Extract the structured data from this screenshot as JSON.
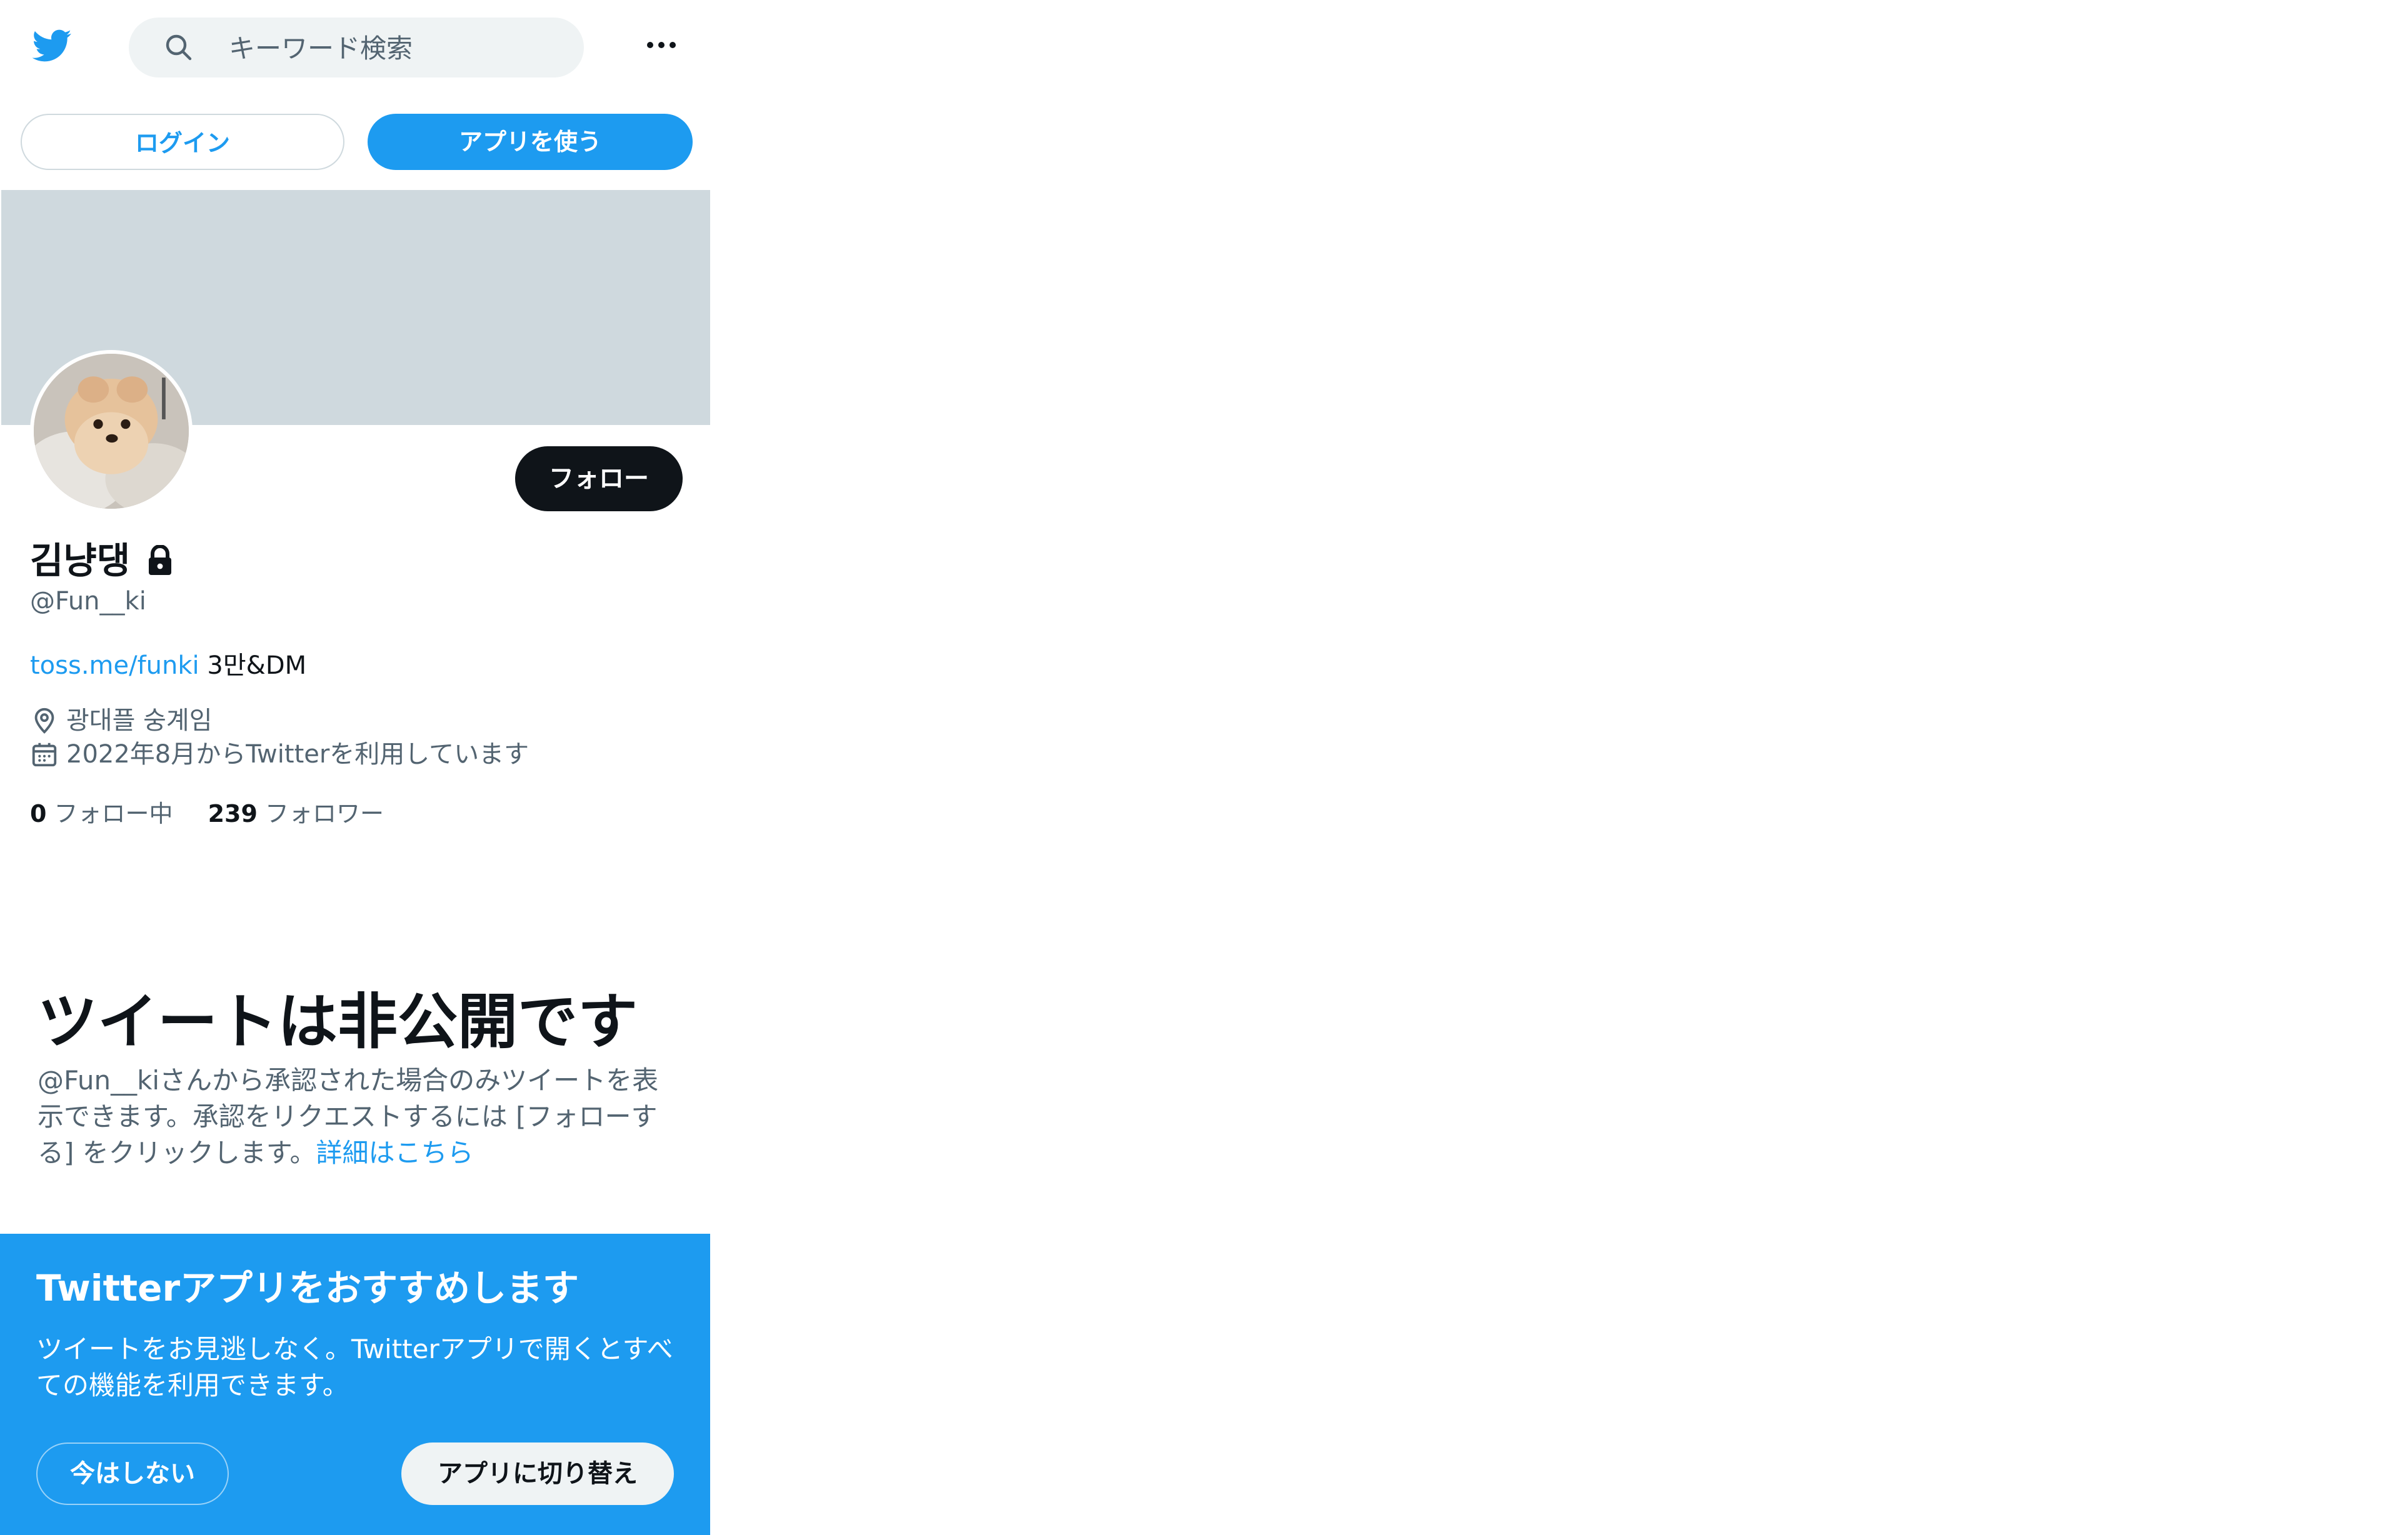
{
  "header": {
    "logo_icon": "twitter-bird-icon",
    "search_placeholder": "キーワード検索",
    "more_icon": "more-dots-icon"
  },
  "auth": {
    "login_label": "ログイン",
    "use_app_label": "アプリを使う"
  },
  "profile": {
    "follow_label": "フォロー",
    "display_name": "김냥댕",
    "protected_icon": "lock-icon",
    "handle": "@Fun__ki",
    "bio_link": "toss.me/funki",
    "bio_text": " 3만&DM",
    "location": "광대플 숭계임",
    "joined": "2022年8月からTwitterを利用しています",
    "following_count": "0",
    "following_label": "フォロー中",
    "followers_count": "239",
    "followers_label": "フォロワー"
  },
  "private_notice": {
    "title": "ツイートは非公開です",
    "body": "@Fun__kiさんから承認された場合のみツイートを表示できます。承認をリクエストするには [フォローする] をクリックします。",
    "learn_more": "詳細はこちら"
  },
  "app_promo": {
    "title": "Twitterアプリをおすすめします",
    "body": "ツイートをお見逃しなく。Twitterアプリで開くとすべての機能を利用できます。",
    "not_now_label": "今はしない",
    "switch_label": "アプリに切り替え"
  },
  "colors": {
    "brand_blue": "#1d9bf0",
    "text_primary": "#0f1419",
    "text_secondary": "#536471",
    "banner_gray": "#cfd9de",
    "search_bg": "#eff3f4"
  }
}
